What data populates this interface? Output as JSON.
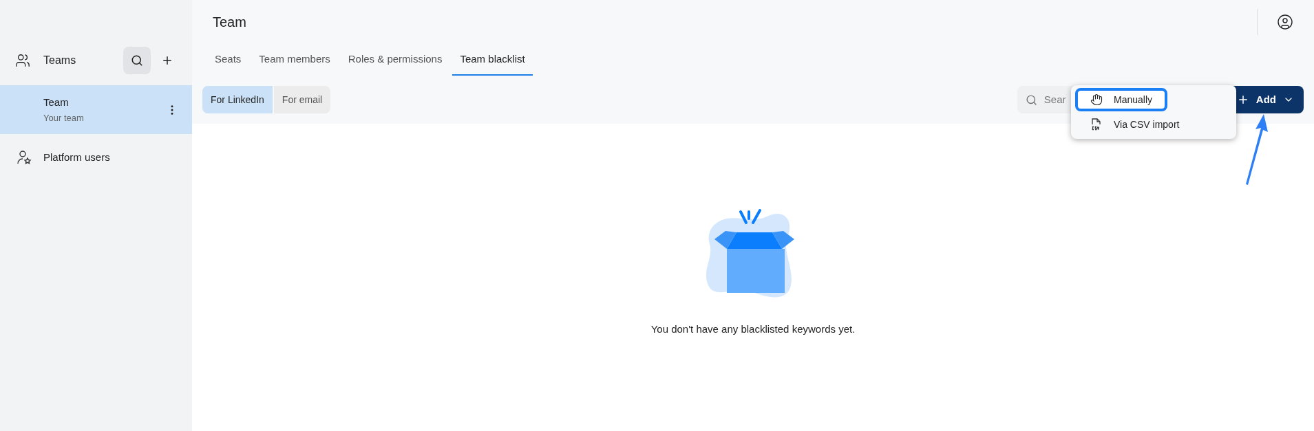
{
  "sidebar": {
    "header": {
      "label": "Teams"
    },
    "items": [
      {
        "title": "Team",
        "subtitle": "Your team",
        "selected": true
      }
    ],
    "footer_item": {
      "label": "Platform users"
    }
  },
  "page": {
    "title": "Team"
  },
  "tabs": [
    {
      "label": "Seats",
      "selected": false
    },
    {
      "label": "Team members",
      "selected": false
    },
    {
      "label": "Roles & permissions",
      "selected": false
    },
    {
      "label": "Team blacklist",
      "selected": true
    }
  ],
  "filters": [
    {
      "label": "For LinkedIn",
      "selected": true
    },
    {
      "label": "For email",
      "selected": false
    }
  ],
  "search": {
    "placeholder": "Sear"
  },
  "add_button": {
    "label": "Add"
  },
  "add_menu": [
    {
      "kind": "hand",
      "label": "Manually",
      "highlighted": true
    },
    {
      "kind": "csv",
      "label": "Via CSV import",
      "highlighted": false
    }
  ],
  "empty_state": {
    "message": "You don't have any blacklisted keywords yet."
  }
}
